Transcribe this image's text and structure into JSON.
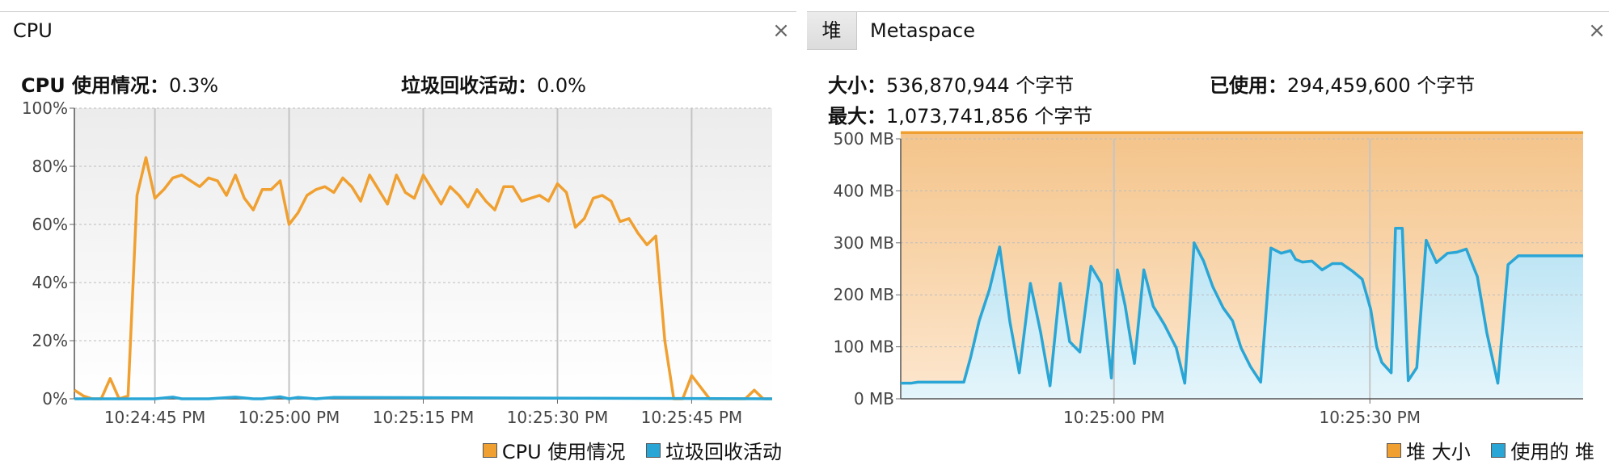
{
  "cpu_panel": {
    "tab_label": "CPU",
    "close_glyph": "×",
    "cpu_usage_label": "CPU 使用情况",
    "cpu_usage_value": "0.3%",
    "gc_label": "垃圾回收活动",
    "gc_value": "0.0%",
    "separator": "："
  },
  "memory_panel": {
    "tabs": [
      {
        "label": "堆",
        "active": false
      },
      {
        "label": "Metaspace",
        "active": true
      }
    ],
    "close_glyph": "×",
    "size_label": "大小",
    "size_value": "536,870,944 个字节",
    "used_label": "已使用",
    "used_value": "294,459,600 个字节",
    "max_label": "最大",
    "max_value": "1,073,741,856 个字节",
    "separator": "："
  },
  "colors": {
    "orange": "#f0a030",
    "blue": "#2aa6d6",
    "plot_bg_top": "#ececec",
    "plot_bg_bottom": "#ffffff",
    "heap_fill_top": "#f4c48a",
    "heap_fill_bottom": "#fde7cf",
    "used_fill_top": "#b7e2f3",
    "used_fill_bottom": "#e4f5fb"
  },
  "chart_data": [
    {
      "type": "line",
      "title": "",
      "xlabel": "",
      "ylabel": "",
      "ylim": [
        0,
        100
      ],
      "yticks": [
        "0%",
        "20%",
        "40%",
        "60%",
        "80%",
        "100%"
      ],
      "xticks": [
        "10:24:45 PM",
        "10:25:00 PM",
        "10:25:15 PM",
        "10:25:30 PM",
        "10:25:45 PM"
      ],
      "x_unit": "seconds after 10:24:36 PM",
      "xtick_seconds": [
        9,
        24,
        39,
        54,
        69
      ],
      "x_range_seconds": [
        0,
        78
      ],
      "grid": true,
      "legend": "bottom-right",
      "series": [
        {
          "name": "CPU 使用情况",
          "color": "#f0a030",
          "x": [
            0,
            1,
            2,
            3,
            4,
            5,
            6,
            7,
            8,
            9,
            10,
            11,
            12,
            13,
            14,
            15,
            16,
            17,
            18,
            19,
            20,
            21,
            22,
            23,
            24,
            25,
            26,
            27,
            28,
            29,
            30,
            31,
            32,
            33,
            34,
            35,
            36,
            37,
            38,
            39,
            40,
            41,
            42,
            43,
            44,
            45,
            46,
            47,
            48,
            49,
            50,
            51,
            52,
            53,
            54,
            55,
            56,
            57,
            58,
            59,
            60,
            61,
            62,
            63,
            64,
            65,
            66,
            67,
            68,
            69,
            70,
            71,
            72,
            73,
            74,
            75,
            76,
            77,
            78
          ],
          "values": [
            3,
            1,
            0,
            0,
            7,
            0,
            1,
            70,
            83,
            69,
            72,
            76,
            77,
            75,
            73,
            76,
            75,
            70,
            77,
            69,
            65,
            72,
            72,
            75,
            60,
            64,
            70,
            72,
            73,
            71,
            76,
            73,
            68,
            77,
            72,
            67,
            77,
            71,
            69,
            77,
            72,
            67,
            73,
            70,
            66,
            72,
            68,
            65,
            73,
            73,
            68,
            69,
            70,
            68,
            74,
            71,
            59,
            62,
            69,
            70,
            68,
            61,
            62,
            57,
            53,
            56,
            20,
            0,
            0,
            8,
            4,
            0,
            0,
            0,
            0,
            0,
            3,
            0,
            0
          ]
        },
        {
          "name": "垃圾回收活动",
          "color": "#2aa6d6",
          "x": [
            0,
            9,
            11,
            12,
            15,
            18,
            20,
            21,
            23,
            24,
            25,
            27,
            29,
            78
          ],
          "values": [
            0,
            0,
            0.6,
            0,
            0,
            0.6,
            0,
            0,
            0.7,
            0,
            0.5,
            0,
            0.5,
            0
          ]
        }
      ]
    },
    {
      "type": "area",
      "title": "",
      "xlabel": "",
      "ylabel": "",
      "ylim": [
        0,
        500
      ],
      "yticks": [
        "0 MB",
        "100 MB",
        "200 MB",
        "300 MB",
        "400 MB",
        "500 MB"
      ],
      "xticks": [
        "10:25:00 PM",
        "10:25:30 PM"
      ],
      "x_unit": "seconds after 10:24:35 PM",
      "xtick_seconds": [
        25,
        55
      ],
      "x_range_seconds": [
        0,
        80
      ],
      "grid": true,
      "legend": "bottom-right",
      "series": [
        {
          "name": "堆 大小",
          "color": "#f0a030",
          "x": [
            0,
            80
          ],
          "values": [
            512,
            512
          ]
        },
        {
          "name": "使用的 堆",
          "color": "#2aa6d6",
          "x": [
            0,
            1.2,
            2,
            2.6,
            3.4,
            4.4,
            5.6,
            7.4,
            8.2,
            9.2,
            10.4,
            11.6,
            12.8,
            13.9,
            15.2,
            16.4,
            17.5,
            18.7,
            19.8,
            21,
            22.3,
            23.5,
            24.7,
            25.4,
            26.3,
            27.4,
            28.5,
            29.6,
            30.9,
            32.3,
            33.3,
            34.4,
            35.5,
            36.6,
            37.8,
            38.9,
            39.9,
            41,
            42.2,
            43.4,
            44.6,
            45.7,
            46.3,
            47.1,
            48.2,
            49.4,
            50.6,
            51.7,
            53,
            54.1,
            55.1,
            55.8,
            56.4,
            57.5,
            58,
            58.8,
            59.5,
            60.5,
            61.6,
            62.8,
            64.1,
            65.2,
            66.3,
            67.6,
            68.7,
            70,
            71.2,
            72.4,
            73.4,
            74.6,
            75.8,
            80
          ],
          "values": [
            30,
            30,
            32,
            32,
            32,
            32,
            32,
            32,
            80,
            150,
            210,
            292,
            148,
            50,
            222,
            128,
            25,
            222,
            110,
            90,
            255,
            222,
            40,
            248,
            180,
            68,
            248,
            178,
            143,
            98,
            30,
            300,
            265,
            215,
            175,
            150,
            98,
            62,
            32,
            290,
            280,
            285,
            268,
            263,
            265,
            248,
            260,
            260,
            245,
            230,
            172,
            100,
            70,
            50,
            328,
            328,
            35,
            60,
            305,
            262,
            280,
            282,
            288,
            235,
            128,
            30,
            258,
            275,
            275,
            275,
            275,
            275
          ]
        }
      ]
    }
  ]
}
